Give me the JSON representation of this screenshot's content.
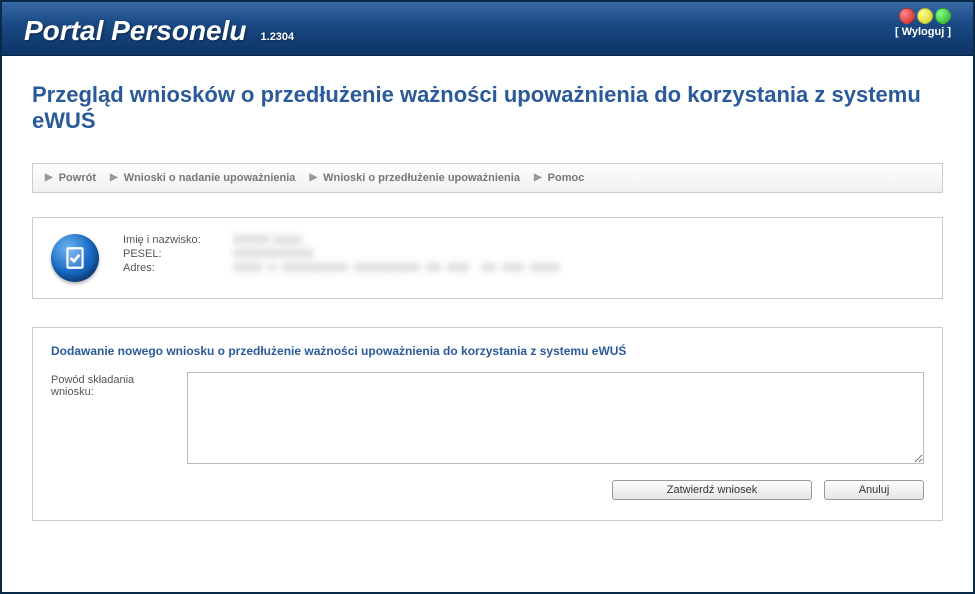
{
  "header": {
    "title": "Portal Personelu",
    "version": "1.2304",
    "logout_label": "[ Wyloguj ]"
  },
  "page": {
    "title": "Przegląd wniosków o przedłużenie ważności upoważnienia do korzystania z systemu eWUŚ"
  },
  "nav": {
    "items": [
      {
        "label": "Powrót"
      },
      {
        "label": "Wnioski o nadanie upoważnienia"
      },
      {
        "label": "Wnioski o przedłużenie upoważnienia"
      },
      {
        "label": "Pomoc"
      }
    ]
  },
  "info": {
    "fields": {
      "name_label": "Imię i nazwisko:",
      "name_value": "XXXXX Xxxxx",
      "pesel_label": "PESEL:",
      "pesel_value": "XXXXXXXXXXX",
      "address_label": "Adres:",
      "address_value": "XXXX  X  XXXXXXXXX  XXXXXXXXX  XX  XXX    XX  XXX  XXXX"
    }
  },
  "form": {
    "title": "Dodawanie nowego wniosku o przedłużenie ważności upoważnienia do korzystania z systemu eWUŚ",
    "reason_label": "Powód składania wniosku:",
    "reason_value": "",
    "submit_label": "Zatwierdź wniosek",
    "cancel_label": "Anuluj"
  }
}
